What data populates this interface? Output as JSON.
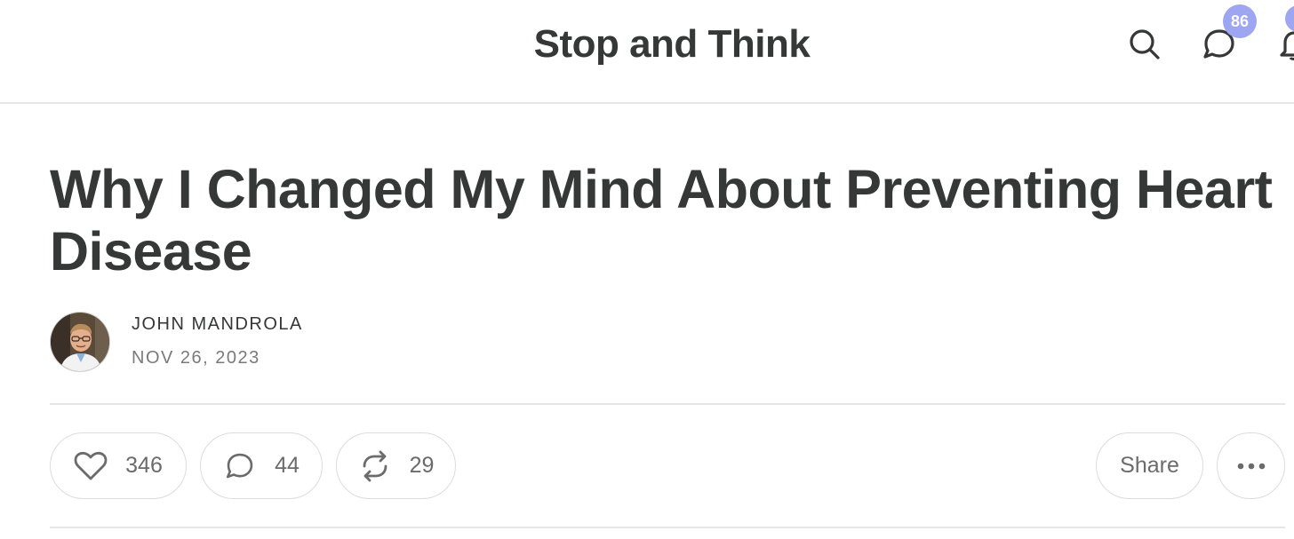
{
  "header": {
    "publication_title": "Stop and Think",
    "icons": [
      "search-icon",
      "comment-icon",
      "bell-icon"
    ],
    "notification_badge": "86"
  },
  "post": {
    "title": "Why I Changed My Mind About Preventing Heart Disease",
    "author": "JOHN MANDROLA",
    "date": "NOV 26, 2023"
  },
  "actions": {
    "likes": "346",
    "comments": "44",
    "restacks": "29",
    "share_label": "Share"
  },
  "colors": {
    "text": "#363737",
    "muted": "#7a7a7a",
    "badge": "#9ea6f1",
    "border": "#dcdcdc"
  }
}
